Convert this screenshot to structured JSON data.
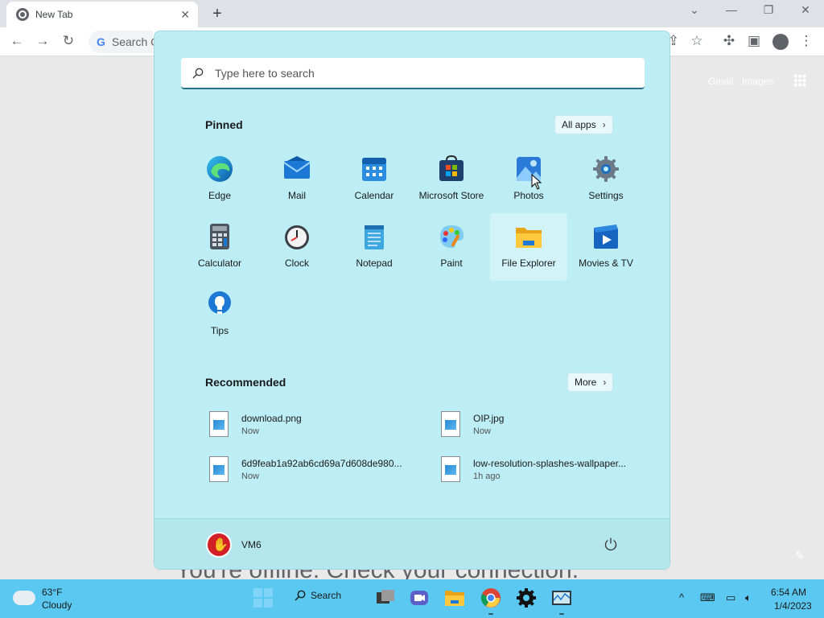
{
  "browser": {
    "tab_title": "New Tab",
    "tab_close": "✕",
    "new_tab": "+",
    "omnibox_placeholder": "Search G",
    "header_links": {
      "gmail": "Gmail",
      "images": "Images"
    },
    "offline_message": "You're offline. Check your connection."
  },
  "start_menu": {
    "search_placeholder": "Type here to search",
    "pinned_title": "Pinned",
    "all_apps_label": "All apps",
    "pinned_apps": [
      {
        "label": "Edge",
        "icon": "edge-icon"
      },
      {
        "label": "Mail",
        "icon": "mail-icon"
      },
      {
        "label": "Calendar",
        "icon": "calendar-icon"
      },
      {
        "label": "Microsoft Store",
        "icon": "store-icon"
      },
      {
        "label": "Photos",
        "icon": "photos-icon"
      },
      {
        "label": "Settings",
        "icon": "settings-icon"
      },
      {
        "label": "Calculator",
        "icon": "calculator-icon"
      },
      {
        "label": "Clock",
        "icon": "clock-icon"
      },
      {
        "label": "Notepad",
        "icon": "notepad-icon"
      },
      {
        "label": "Paint",
        "icon": "paint-icon"
      },
      {
        "label": "File Explorer",
        "icon": "folder-icon"
      },
      {
        "label": "Movies & TV",
        "icon": "movies-icon"
      },
      {
        "label": "Tips",
        "icon": "tips-icon"
      }
    ],
    "recommended_title": "Recommended",
    "more_label": "More",
    "recommended": [
      {
        "name": "download.png",
        "time": "Now"
      },
      {
        "name": "OIP.jpg",
        "time": "Now"
      },
      {
        "name": "6d9feab1a92ab6cd69a7d608de980...",
        "time": "Now"
      },
      {
        "name": "low-resolution-splashes-wallpaper...",
        "time": "1h ago"
      }
    ],
    "user_name": "VM6"
  },
  "taskbar": {
    "weather_temp": "63°F",
    "weather_condition": "Cloudy",
    "search_label": "Search",
    "time": "6:54 AM",
    "date": "1/4/2023"
  }
}
